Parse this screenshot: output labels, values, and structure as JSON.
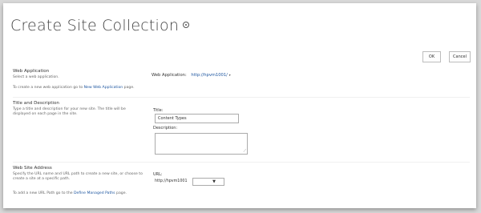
{
  "page": {
    "title": "Create Site Collection"
  },
  "buttons": {
    "ok": "OK",
    "cancel": "Cancel"
  },
  "web_application": {
    "heading": "Web Application",
    "description": "Select a web application.",
    "help_prefix": "To create a new web application go to ",
    "help_link": "New Web Application",
    "help_suffix": " page.",
    "field_label": "Web Application:",
    "value": "http://hpvm1001/"
  },
  "title_description": {
    "heading": "Title and Description",
    "description": "Type a title and description for your new site. The title will be displayed on each page in the site.",
    "title_label": "Title:",
    "title_value": "Content Types",
    "description_label": "Description:",
    "description_value": ""
  },
  "web_site_address": {
    "heading": "Web Site Address",
    "description": "Specify the URL name and URL path to create a new site, or choose to create a site at a specific path.",
    "help_prefix": "To add a new URL Path go to the ",
    "help_link": "Define Managed Paths",
    "help_suffix": " page.",
    "url_label": "URL:",
    "url_prefix": "http://hpvm1001",
    "path_value": ""
  }
}
